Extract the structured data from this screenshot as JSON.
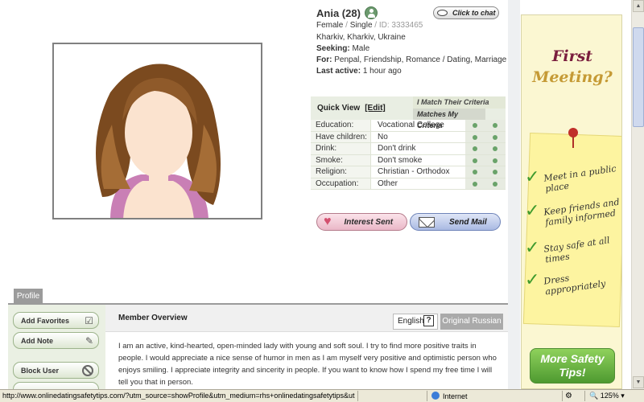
{
  "profile": {
    "name": "Ania (28)",
    "chat_label": "Click to chat",
    "gender_line": {
      "gender": "Female",
      "sep1": " / ",
      "status": "Single",
      "sep2": " / ID: ",
      "id": "3333465"
    },
    "location": "Kharkiv, Kharkiv, Ukraine",
    "seeking_label": "Seeking:",
    "seeking_value": "Male",
    "for_label": "For:",
    "for_value": "Penpal, Friendship, Romance / Dating, Marriage",
    "last_active_label": "Last active:",
    "last_active_value": "1 hour ago"
  },
  "quick_view": {
    "title": "Quick View",
    "edit_label": "[Edit]",
    "col_match_their": "I Match Their Criteria",
    "col_matches_mine": "Matches My Criteria",
    "rows": [
      {
        "label": "Education:",
        "value": "Vocational College"
      },
      {
        "label": "Have children:",
        "value": "No"
      },
      {
        "label": "Drink:",
        "value": "Don't drink"
      },
      {
        "label": "Smoke:",
        "value": "Don't smoke"
      },
      {
        "label": "Religion:",
        "value": "Christian - Orthodox"
      },
      {
        "label": "Occupation:",
        "value": "Other"
      }
    ]
  },
  "actions": {
    "interest_label": "Interest Sent",
    "mail_label": "Send Mail"
  },
  "tabs": {
    "profile_label": "Profile"
  },
  "sidebar": {
    "add_favorites": "Add Favorites",
    "add_note": "Add Note",
    "block_user": "Block User"
  },
  "overview": {
    "title": "Member Overview",
    "lang_english": "English",
    "help_label": "?",
    "lang_original": "Original Russian",
    "text": "I am an active, kind-hearted, open-minded lady with young and soft soul. I try to find more positive traits in people. I would appreciate a nice sense of humor in men as I am myself very positive and optimistic person who enjoys smiling. I appreciate integrity and sincerity in people. If you want to know how I spend my free time I will tell you that in person."
  },
  "ad": {
    "title_line1": "First",
    "title_line2": "Meeting?",
    "tips": [
      "Meet in a public place",
      "Keep friends and family informed",
      "Stay safe at all times",
      "Dress appropriately"
    ],
    "cta": "More Safety Tips!"
  },
  "statusbar": {
    "url": "http://www.onlinedatingsafetytips.com/?utm_source=showProfile&utm_medium=rhs+onlinedatingsafetytips&utm_c",
    "zone": "Internet",
    "zoom": "125%"
  },
  "colors": {
    "accent_green": "#6aa36a",
    "interest_pink": "#eab7c7",
    "mail_blue": "#a9b9e2",
    "ad_burgundy": "#7a1e3e"
  }
}
